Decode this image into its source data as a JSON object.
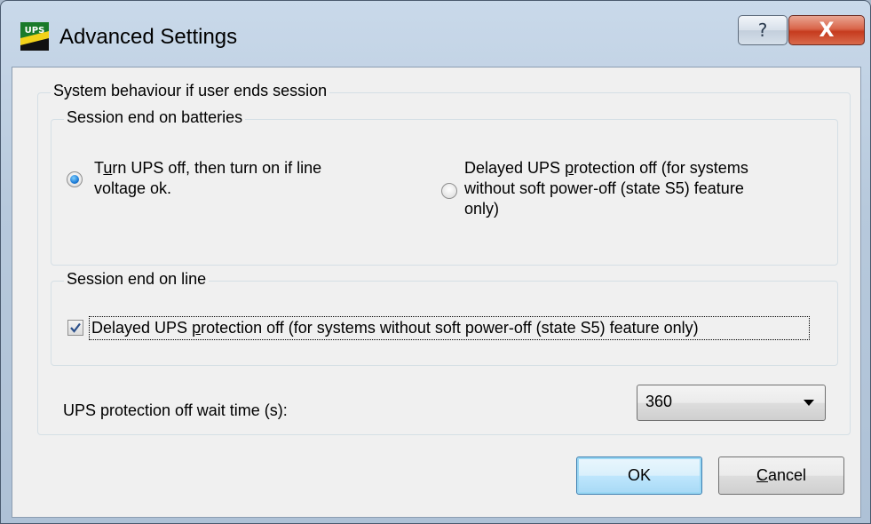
{
  "window": {
    "title": "Advanced Settings",
    "icon_text": "UPS",
    "help_label": "?",
    "close_label": "X"
  },
  "outer_group": {
    "label": "System behaviour if user ends session"
  },
  "batteries_group": {
    "label": "Session end on batteries",
    "option1": {
      "pre": "T",
      "mnemonic": "u",
      "post": "rn UPS off, then turn on if line",
      "line2": "voltage ok.",
      "selected": true
    },
    "option2": {
      "line1_pre": "Delayed UPS ",
      "line1_mnemonic": "p",
      "line1_post": "rotection off (for systems",
      "line2": "without soft power-off (state S5) feature",
      "line3": "only)",
      "selected": false
    }
  },
  "line_group": {
    "label": "Session end on line",
    "checkbox": {
      "pre": "Delayed UPS ",
      "mnemonic": "p",
      "post": "rotection off (for systems without soft power-off (state S5) feature only)",
      "checked": true
    }
  },
  "wait_time": {
    "label": "UPS protection off wait time (s):",
    "value": "360"
  },
  "buttons": {
    "ok": "OK",
    "cancel_mnemonic": "C",
    "cancel_rest": "ancel"
  },
  "colors": {
    "accent": "#1d7bd6",
    "close_red": "#c63b1e"
  },
  "icons": {
    "app": "ups-app-icon",
    "help": "help-icon",
    "close": "close-icon",
    "dropdown": "chevron-down-icon",
    "check": "checkmark-icon"
  }
}
